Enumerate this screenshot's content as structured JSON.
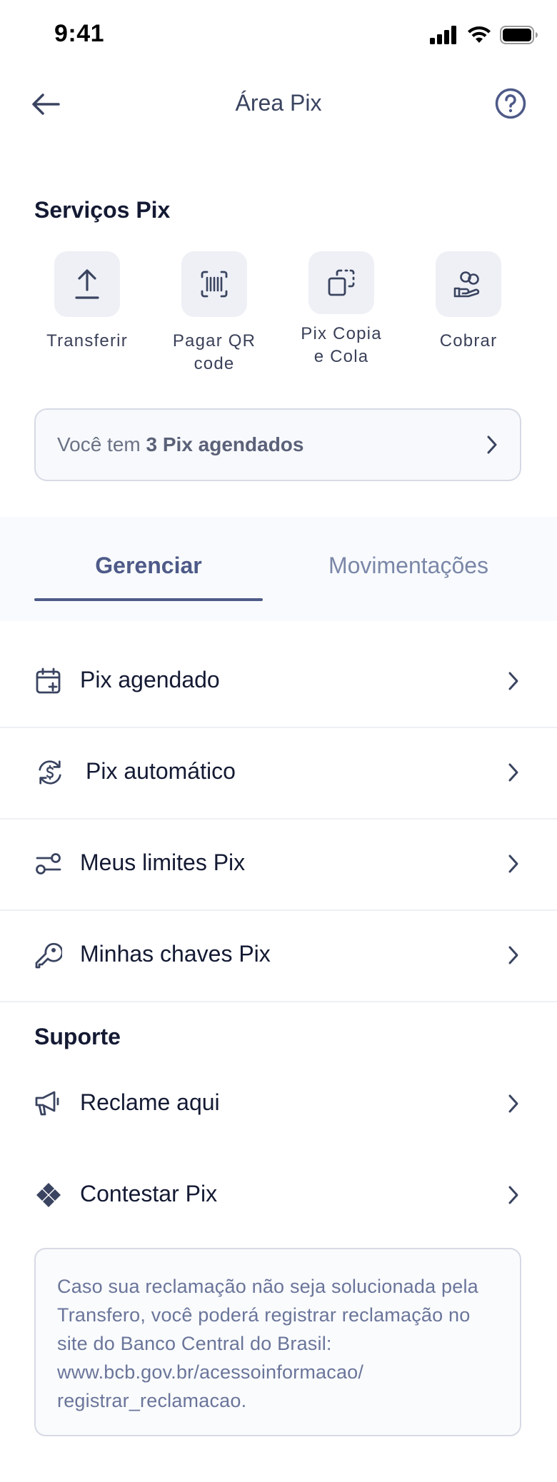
{
  "status_bar": {
    "time": "9:41"
  },
  "header": {
    "title": "Área Pix",
    "back_icon": "arrow-left-icon",
    "help_icon": "question-circle-icon"
  },
  "services": {
    "title": "Serviços Pix",
    "items": [
      {
        "label": "Transferir",
        "icon": "upload-icon"
      },
      {
        "label": "Pagar QR\ncode",
        "icon": "barcode-scan-icon"
      },
      {
        "label": "Pix Copia\ne Cola",
        "icon": "copy-icon"
      },
      {
        "label": "Cobrar",
        "icon": "hand-coins-icon"
      }
    ]
  },
  "scheduled_banner": {
    "prefix": "Você tem ",
    "highlight": "3 Pix agendados"
  },
  "tabs": [
    {
      "label": "Gerenciar",
      "active": true
    },
    {
      "label": "Movimentações",
      "active": false
    }
  ],
  "manage_items": [
    {
      "label": "Pix agendado",
      "icon": "calendar-plus-icon"
    },
    {
      "label": "Pix automático",
      "icon": "refresh-dollar-icon"
    },
    {
      "label": "Meus limites Pix",
      "icon": "sliders-icon"
    },
    {
      "label": "Minhas chaves Pix",
      "icon": "key-icon"
    }
  ],
  "support": {
    "title": "Suporte",
    "items": [
      {
        "label": "Reclame aqui",
        "icon": "megaphone-icon"
      },
      {
        "label": "Contestar Pix",
        "icon": "pix-logo-icon"
      }
    ]
  },
  "info_box": {
    "text": "Caso sua reclamação não seja solucionada pela Transfero, você poderá registrar reclamação no site do Banco Central do Brasil: www.bcb.gov.br/acessoinformacao/ registrar_reclamacao."
  },
  "colors": {
    "accent": "#4e5a88",
    "text_dark": "#141a33",
    "muted": "#7b87a8"
  }
}
